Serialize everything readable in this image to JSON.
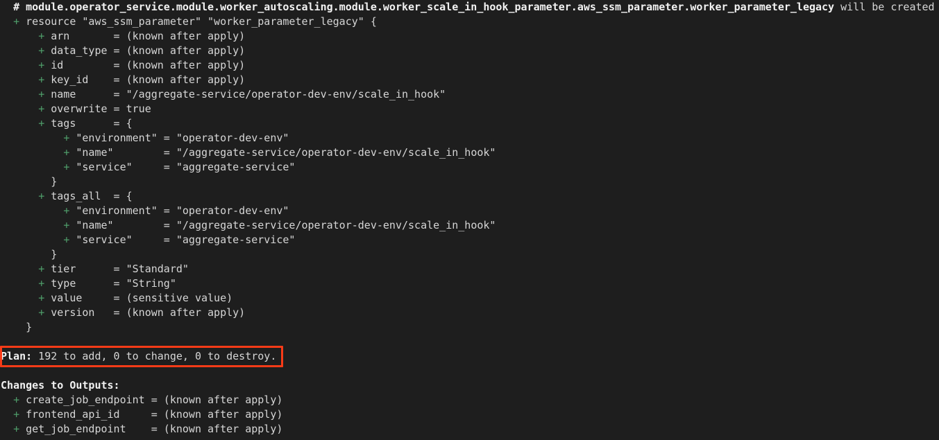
{
  "terminal": {
    "background_color": "#1e1e1e",
    "text_color": "#d6d6d6",
    "plus_color": "#4f9e6a",
    "highlight_color": "#f93b17",
    "tool": "terraform-plan-output"
  },
  "lines": [
    {
      "id": "l01",
      "indent": "  ",
      "plus": "",
      "bold": "# module.operator_service.module.worker_autoscaling.module.worker_scale_in_hook_parameter.aws_ssm_parameter.worker_parameter_legacy",
      "text": " will be created"
    },
    {
      "id": "l02",
      "indent": "  ",
      "plus": "+",
      "bold": "",
      "text": " resource \"aws_ssm_parameter\" \"worker_parameter_legacy\" {"
    },
    {
      "id": "l03",
      "indent": "      ",
      "plus": "+",
      "bold": "",
      "text": " arn       = (known after apply)"
    },
    {
      "id": "l04",
      "indent": "      ",
      "plus": "+",
      "bold": "",
      "text": " data_type = (known after apply)"
    },
    {
      "id": "l05",
      "indent": "      ",
      "plus": "+",
      "bold": "",
      "text": " id        = (known after apply)"
    },
    {
      "id": "l06",
      "indent": "      ",
      "plus": "+",
      "bold": "",
      "text": " key_id    = (known after apply)"
    },
    {
      "id": "l07",
      "indent": "      ",
      "plus": "+",
      "bold": "",
      "text": " name      = \"/aggregate-service/operator-dev-env/scale_in_hook\""
    },
    {
      "id": "l08",
      "indent": "      ",
      "plus": "+",
      "bold": "",
      "text": " overwrite = true"
    },
    {
      "id": "l09",
      "indent": "      ",
      "plus": "+",
      "bold": "",
      "text": " tags      = {"
    },
    {
      "id": "l10",
      "indent": "          ",
      "plus": "+",
      "bold": "",
      "text": " \"environment\" = \"operator-dev-env\""
    },
    {
      "id": "l11",
      "indent": "          ",
      "plus": "+",
      "bold": "",
      "text": " \"name\"        = \"/aggregate-service/operator-dev-env/scale_in_hook\""
    },
    {
      "id": "l12",
      "indent": "          ",
      "plus": "+",
      "bold": "",
      "text": " \"service\"     = \"aggregate-service\""
    },
    {
      "id": "l13",
      "indent": "        ",
      "plus": "",
      "bold": "",
      "text": "}"
    },
    {
      "id": "l14",
      "indent": "      ",
      "plus": "+",
      "bold": "",
      "text": " tags_all  = {"
    },
    {
      "id": "l15",
      "indent": "          ",
      "plus": "+",
      "bold": "",
      "text": " \"environment\" = \"operator-dev-env\""
    },
    {
      "id": "l16",
      "indent": "          ",
      "plus": "+",
      "bold": "",
      "text": " \"name\"        = \"/aggregate-service/operator-dev-env/scale_in_hook\""
    },
    {
      "id": "l17",
      "indent": "          ",
      "plus": "+",
      "bold": "",
      "text": " \"service\"     = \"aggregate-service\""
    },
    {
      "id": "l18",
      "indent": "        ",
      "plus": "",
      "bold": "",
      "text": "}"
    },
    {
      "id": "l19",
      "indent": "      ",
      "plus": "+",
      "bold": "",
      "text": " tier      = \"Standard\""
    },
    {
      "id": "l20",
      "indent": "      ",
      "plus": "+",
      "bold": "",
      "text": " type      = \"String\""
    },
    {
      "id": "l21",
      "indent": "      ",
      "plus": "+",
      "bold": "",
      "text": " value     = (sensitive value)"
    },
    {
      "id": "l22",
      "indent": "      ",
      "plus": "+",
      "bold": "",
      "text": " version   = (known after apply)"
    },
    {
      "id": "l23",
      "indent": "    ",
      "plus": "",
      "bold": "",
      "text": "}"
    },
    {
      "id": "l24",
      "indent": "",
      "plus": "",
      "bold": "",
      "text": ""
    },
    {
      "id": "l25",
      "indent": "",
      "plus": "",
      "bold": "Plan:",
      "text": " 192 to add, 0 to change, 0 to destroy."
    },
    {
      "id": "l26",
      "indent": "",
      "plus": "",
      "bold": "",
      "text": ""
    },
    {
      "id": "l27",
      "indent": "",
      "plus": "",
      "bold": "Changes to Outputs:",
      "text": ""
    },
    {
      "id": "l28",
      "indent": "  ",
      "plus": "+",
      "bold": "",
      "text": " create_job_endpoint = (known after apply)"
    },
    {
      "id": "l29",
      "indent": "  ",
      "plus": "+",
      "bold": "",
      "text": " frontend_api_id     = (known after apply)"
    },
    {
      "id": "l30",
      "indent": "  ",
      "plus": "+",
      "bold": "",
      "text": " get_job_endpoint    = (known after apply)"
    }
  ],
  "plan_summary": {
    "label": "Plan:",
    "add": "192",
    "change": "0",
    "destroy": "0",
    "full_text": "Plan: 192 to add, 0 to change, 0 to destroy."
  },
  "resource": {
    "address": "module.operator_service.module.worker_autoscaling.module.worker_scale_in_hook_parameter.aws_ssm_parameter.worker_parameter_legacy",
    "action": "will be created",
    "type": "aws_ssm_parameter",
    "name": "worker_parameter_legacy",
    "attributes": {
      "arn": "(known after apply)",
      "data_type": "(known after apply)",
      "id": "(known after apply)",
      "key_id": "(known after apply)",
      "name": "/aggregate-service/operator-dev-env/scale_in_hook",
      "overwrite": "true",
      "tier": "Standard",
      "type": "String",
      "value": "(sensitive value)",
      "version": "(known after apply)"
    },
    "tags": {
      "environment": "operator-dev-env",
      "name": "/aggregate-service/operator-dev-env/scale_in_hook",
      "service": "aggregate-service"
    },
    "tags_all": {
      "environment": "operator-dev-env",
      "name": "/aggregate-service/operator-dev-env/scale_in_hook",
      "service": "aggregate-service"
    }
  },
  "outputs": {
    "heading": "Changes to Outputs:",
    "items": [
      {
        "name": "create_job_endpoint",
        "value": "(known after apply)"
      },
      {
        "name": "frontend_api_id",
        "value": "(known after apply)"
      },
      {
        "name": "get_job_endpoint",
        "value": "(known after apply)"
      }
    ]
  }
}
